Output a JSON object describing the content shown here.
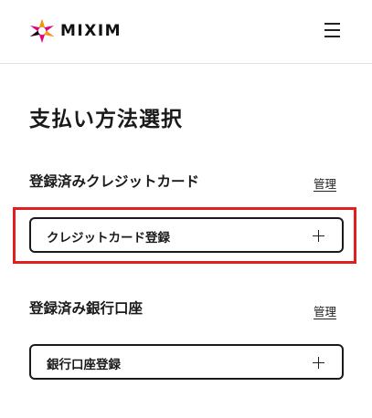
{
  "header": {
    "logo_text": "MIXIM",
    "menu_icon": "hamburger-menu-icon"
  },
  "page": {
    "title": "支払い方法選択"
  },
  "credit_card_section": {
    "title": "登録済みクレジットカード",
    "manage_label": "管理",
    "register_button_label": "クレジットカード登録",
    "register_button_icon": "plus-icon"
  },
  "bank_section": {
    "title": "登録済み銀行口座",
    "manage_label": "管理",
    "register_button_label": "銀行口座登録",
    "register_button_icon": "plus-icon"
  },
  "colors": {
    "highlight_border": "#e02020",
    "text": "#1a1a1a",
    "logo_pink": "#e4007f",
    "logo_orange": "#f39800"
  }
}
